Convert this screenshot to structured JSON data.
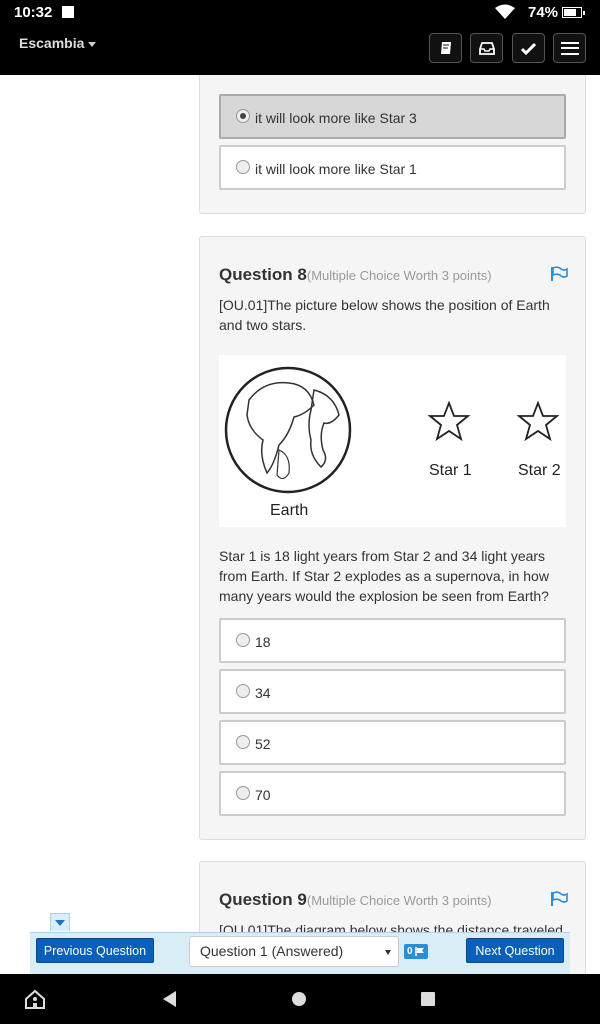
{
  "status_bar": {
    "time": "10:32",
    "battery": "74%"
  },
  "header": {
    "district": "Escambia"
  },
  "question7": {
    "options": [
      {
        "label": "it will look more like Star 3",
        "selected": true
      },
      {
        "label": "it will look more like Star 1",
        "selected": false
      }
    ]
  },
  "question8": {
    "title": "Question 8",
    "meta": "(Multiple Choice Worth 3 points)",
    "intro": "[OU.01]The picture below shows the position of Earth and two stars.",
    "figure": {
      "earth_label": "Earth",
      "star1_label": "Star 1",
      "star2_label": "Star 2"
    },
    "prompt": "Star 1 is 18 light years from Star 2 and 34 light years from Earth. If Star 2 explodes as a supernova, in how many years would the explosion be seen from Earth?",
    "options": [
      {
        "label": "18"
      },
      {
        "label": "34"
      },
      {
        "label": "52"
      },
      {
        "label": "70"
      }
    ]
  },
  "question9": {
    "title": "Question 9",
    "meta": "(Multiple Choice Worth 3 points)",
    "intro": "[OU.01]The diagram below shows the distance traveled"
  },
  "bottom_nav": {
    "prev_label": "Previous Question",
    "select_value": "Question 1 (Answered)",
    "flag_count": "0",
    "next_label": "Next Question"
  },
  "colors": {
    "accent": "#0a5fb8",
    "flag": "#2a8fd6",
    "nav_bg": "#d9edf7"
  }
}
